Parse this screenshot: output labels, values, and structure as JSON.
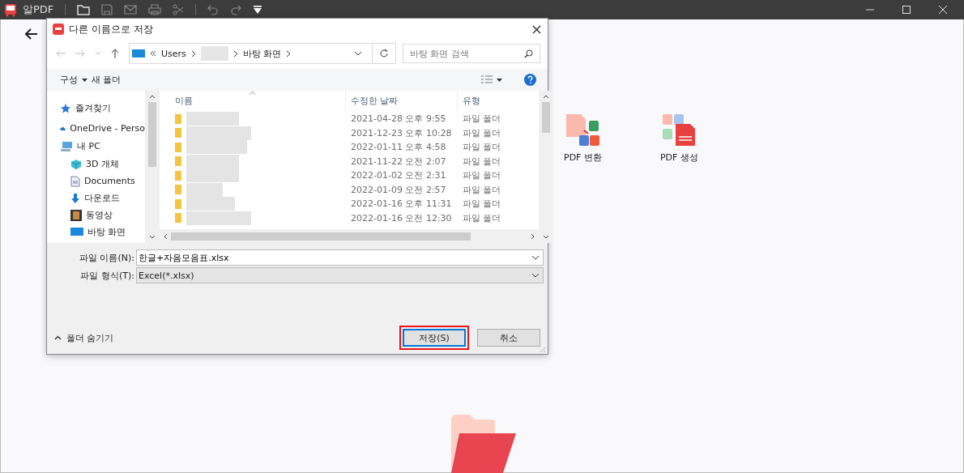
{
  "app": {
    "title": "알PDF"
  },
  "tiles": [
    {
      "label": "PDF 변환"
    },
    {
      "label": "PDF 생성"
    }
  ],
  "dialog": {
    "title": "다른 이름으로 저장",
    "address": {
      "segments": [
        "Users",
        "바탕 화면"
      ]
    },
    "search": {
      "placeholder": "바탕 화면 검색"
    },
    "commands": [
      "구성",
      "새 폴더"
    ],
    "nav": [
      {
        "label": "즐겨찾기"
      },
      {
        "label": "OneDrive - Perso"
      },
      {
        "label": "내 PC",
        "children": [
          {
            "label": "3D 개체"
          },
          {
            "label": "Documents"
          },
          {
            "label": "다운로드"
          },
          {
            "label": "동영상"
          },
          {
            "label": "바탕 화면"
          }
        ]
      }
    ],
    "columns": [
      {
        "label": "이름",
        "sorted": true
      },
      {
        "label": "수정한 날짜",
        "sorted": false
      },
      {
        "label": "유형",
        "sorted": false
      }
    ],
    "rows": [
      {
        "modified": "2021-04-28 오후 9:55",
        "type": "파일 폴더"
      },
      {
        "modified": "2021-12-23 오후 10:28",
        "type": "파일 폴더"
      },
      {
        "modified": "2022-01-11 오후 4:58",
        "type": "파일 폴더"
      },
      {
        "modified": "2021-11-22 오전 2:07",
        "type": "파일 폴더"
      },
      {
        "modified": "2022-01-02 오전 2:31",
        "type": "파일 폴더"
      },
      {
        "modified": "2022-01-09 오전 2:57",
        "type": "파일 폴더"
      },
      {
        "modified": "2022-01-16 오후 11:31",
        "type": "파일 폴더"
      },
      {
        "modified": "2022-01-16 오전 12:30",
        "type": "파일 폴더"
      }
    ],
    "file_name": {
      "label": "파일 이름(N):",
      "value": "한글+자음모음표.xlsx"
    },
    "file_type": {
      "label": "파일 형식(T):",
      "value": "Excel(*.xlsx)"
    },
    "hide_folders": "폴더 숨기기",
    "buttons": [
      {
        "label": "저장(S)",
        "highlighted": true
      },
      {
        "label": "취소",
        "highlighted": false
      }
    ]
  }
}
